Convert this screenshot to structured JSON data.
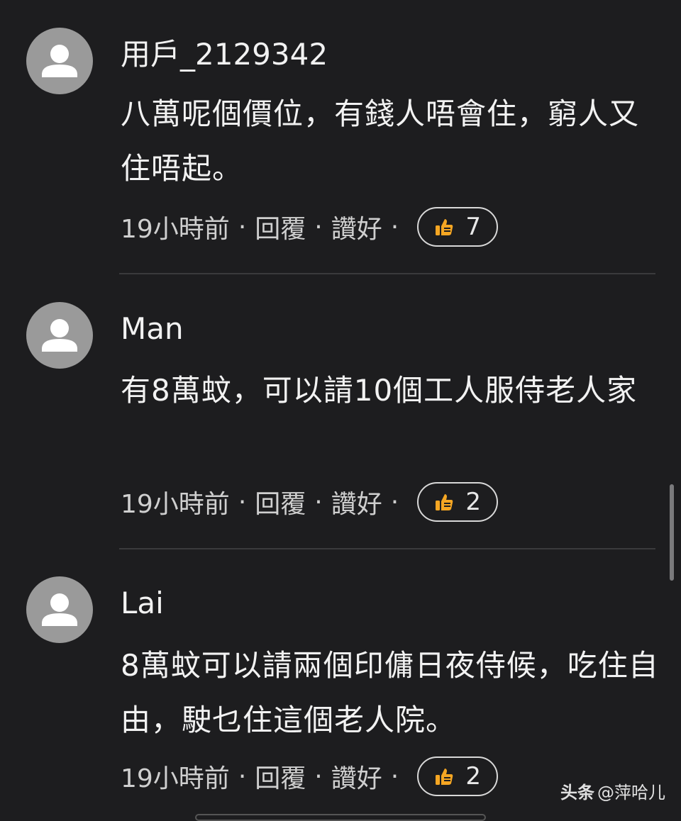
{
  "comments": [
    {
      "username": "用戶_2129342",
      "text": "八萬呢個價位，有錢人唔會住，窮人又住唔起。",
      "time": "19小時前",
      "reply": "回覆",
      "like": "讚好",
      "like_count": "7",
      "separator": "·"
    },
    {
      "username": "Man",
      "text": "有8萬蚊，可以請10個工人服侍老人家",
      "time": "19小時前",
      "reply": "回覆",
      "like": "讚好",
      "like_count": "2",
      "separator": "·"
    },
    {
      "username": "Lai",
      "text": "8萬蚊可以請兩個印傭日夜侍候，吃住自由，駛乜住這個老人院。",
      "time": "19小時前",
      "reply": "回覆",
      "like": "讚好",
      "like_count": "2",
      "separator": "·"
    }
  ],
  "watermark": {
    "brand": "头条",
    "handle": "@萍哈儿"
  },
  "colors": {
    "background": "#1d1d1f",
    "avatar": "#9a9a9a",
    "thumb": "#f5a623"
  },
  "icons": {
    "avatar": "user-avatar-icon",
    "like": "thumbs-up-icon"
  }
}
